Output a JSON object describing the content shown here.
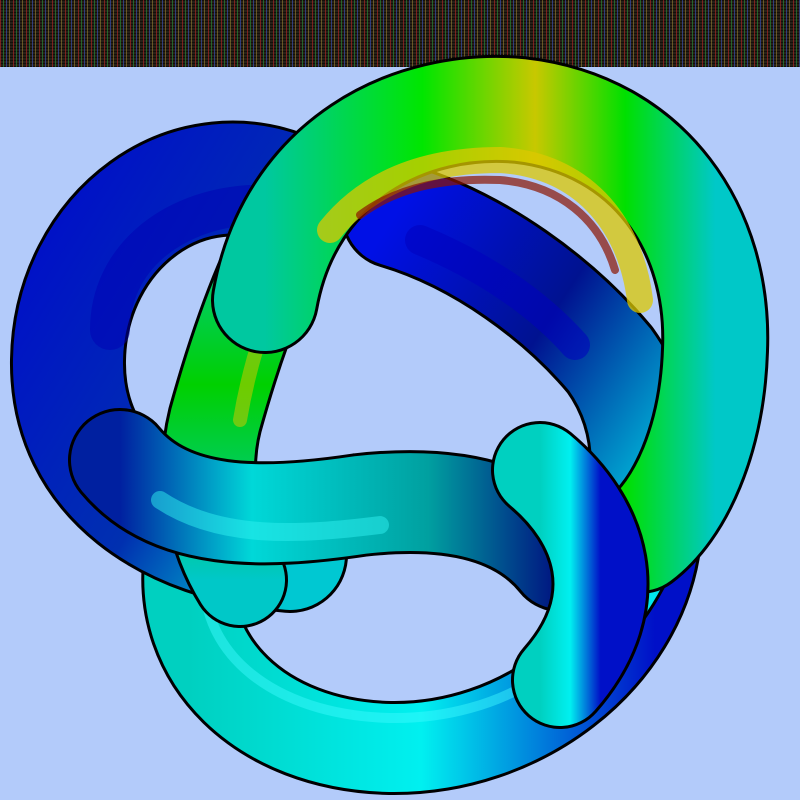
{
  "scene": {
    "subject": "trefoil-knot",
    "background_color": "#b3cbfa",
    "noise_band_color": "#1a140c",
    "palette": {
      "deep_blue": "#000a8c",
      "blue": "#0010e0",
      "cyan": "#00f0f0",
      "teal": "#00b4b4",
      "green": "#00e600",
      "yellow": "#d2c800",
      "dark_red": "#780000",
      "outline": "#000000"
    }
  }
}
